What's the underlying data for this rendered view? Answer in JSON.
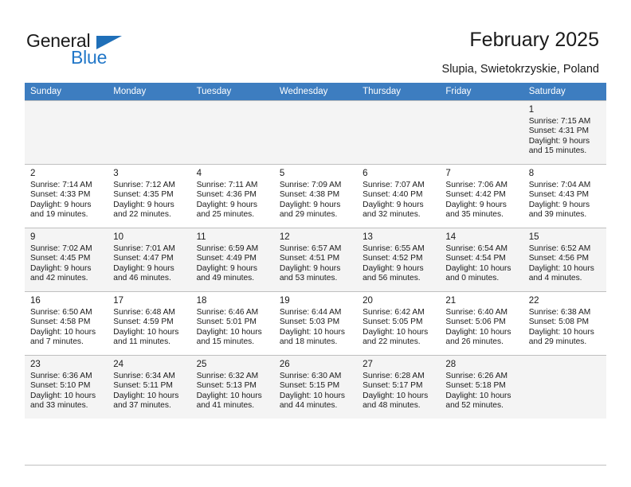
{
  "brand": {
    "name_part1": "General",
    "name_part2": "Blue",
    "triangle_icon": "triangle-icon",
    "accent_color": "#2277c8"
  },
  "header": {
    "title": "February 2025",
    "location": "Slupia, Swietokrzyskie, Poland"
  },
  "calendar": {
    "header_bg": "#3d7dc0",
    "weekdays": [
      "Sunday",
      "Monday",
      "Tuesday",
      "Wednesday",
      "Thursday",
      "Friday",
      "Saturday"
    ],
    "weeks": [
      [
        {
          "day": "",
          "detail": ""
        },
        {
          "day": "",
          "detail": ""
        },
        {
          "day": "",
          "detail": ""
        },
        {
          "day": "",
          "detail": ""
        },
        {
          "day": "",
          "detail": ""
        },
        {
          "day": "",
          "detail": ""
        },
        {
          "day": "1",
          "detail": "Sunrise: 7:15 AM\nSunset: 4:31 PM\nDaylight: 9 hours\nand 15 minutes."
        }
      ],
      [
        {
          "day": "2",
          "detail": "Sunrise: 7:14 AM\nSunset: 4:33 PM\nDaylight: 9 hours\nand 19 minutes."
        },
        {
          "day": "3",
          "detail": "Sunrise: 7:12 AM\nSunset: 4:35 PM\nDaylight: 9 hours\nand 22 minutes."
        },
        {
          "day": "4",
          "detail": "Sunrise: 7:11 AM\nSunset: 4:36 PM\nDaylight: 9 hours\nand 25 minutes."
        },
        {
          "day": "5",
          "detail": "Sunrise: 7:09 AM\nSunset: 4:38 PM\nDaylight: 9 hours\nand 29 minutes."
        },
        {
          "day": "6",
          "detail": "Sunrise: 7:07 AM\nSunset: 4:40 PM\nDaylight: 9 hours\nand 32 minutes."
        },
        {
          "day": "7",
          "detail": "Sunrise: 7:06 AM\nSunset: 4:42 PM\nDaylight: 9 hours\nand 35 minutes."
        },
        {
          "day": "8",
          "detail": "Sunrise: 7:04 AM\nSunset: 4:43 PM\nDaylight: 9 hours\nand 39 minutes."
        }
      ],
      [
        {
          "day": "9",
          "detail": "Sunrise: 7:02 AM\nSunset: 4:45 PM\nDaylight: 9 hours\nand 42 minutes."
        },
        {
          "day": "10",
          "detail": "Sunrise: 7:01 AM\nSunset: 4:47 PM\nDaylight: 9 hours\nand 46 minutes."
        },
        {
          "day": "11",
          "detail": "Sunrise: 6:59 AM\nSunset: 4:49 PM\nDaylight: 9 hours\nand 49 minutes."
        },
        {
          "day": "12",
          "detail": "Sunrise: 6:57 AM\nSunset: 4:51 PM\nDaylight: 9 hours\nand 53 minutes."
        },
        {
          "day": "13",
          "detail": "Sunrise: 6:55 AM\nSunset: 4:52 PM\nDaylight: 9 hours\nand 56 minutes."
        },
        {
          "day": "14",
          "detail": "Sunrise: 6:54 AM\nSunset: 4:54 PM\nDaylight: 10 hours\nand 0 minutes."
        },
        {
          "day": "15",
          "detail": "Sunrise: 6:52 AM\nSunset: 4:56 PM\nDaylight: 10 hours\nand 4 minutes."
        }
      ],
      [
        {
          "day": "16",
          "detail": "Sunrise: 6:50 AM\nSunset: 4:58 PM\nDaylight: 10 hours\nand 7 minutes."
        },
        {
          "day": "17",
          "detail": "Sunrise: 6:48 AM\nSunset: 4:59 PM\nDaylight: 10 hours\nand 11 minutes."
        },
        {
          "day": "18",
          "detail": "Sunrise: 6:46 AM\nSunset: 5:01 PM\nDaylight: 10 hours\nand 15 minutes."
        },
        {
          "day": "19",
          "detail": "Sunrise: 6:44 AM\nSunset: 5:03 PM\nDaylight: 10 hours\nand 18 minutes."
        },
        {
          "day": "20",
          "detail": "Sunrise: 6:42 AM\nSunset: 5:05 PM\nDaylight: 10 hours\nand 22 minutes."
        },
        {
          "day": "21",
          "detail": "Sunrise: 6:40 AM\nSunset: 5:06 PM\nDaylight: 10 hours\nand 26 minutes."
        },
        {
          "day": "22",
          "detail": "Sunrise: 6:38 AM\nSunset: 5:08 PM\nDaylight: 10 hours\nand 29 minutes."
        }
      ],
      [
        {
          "day": "23",
          "detail": "Sunrise: 6:36 AM\nSunset: 5:10 PM\nDaylight: 10 hours\nand 33 minutes."
        },
        {
          "day": "24",
          "detail": "Sunrise: 6:34 AM\nSunset: 5:11 PM\nDaylight: 10 hours\nand 37 minutes."
        },
        {
          "day": "25",
          "detail": "Sunrise: 6:32 AM\nSunset: 5:13 PM\nDaylight: 10 hours\nand 41 minutes."
        },
        {
          "day": "26",
          "detail": "Sunrise: 6:30 AM\nSunset: 5:15 PM\nDaylight: 10 hours\nand 44 minutes."
        },
        {
          "day": "27",
          "detail": "Sunrise: 6:28 AM\nSunset: 5:17 PM\nDaylight: 10 hours\nand 48 minutes."
        },
        {
          "day": "28",
          "detail": "Sunrise: 6:26 AM\nSunset: 5:18 PM\nDaylight: 10 hours\nand 52 minutes."
        },
        {
          "day": "",
          "detail": ""
        }
      ]
    ]
  }
}
